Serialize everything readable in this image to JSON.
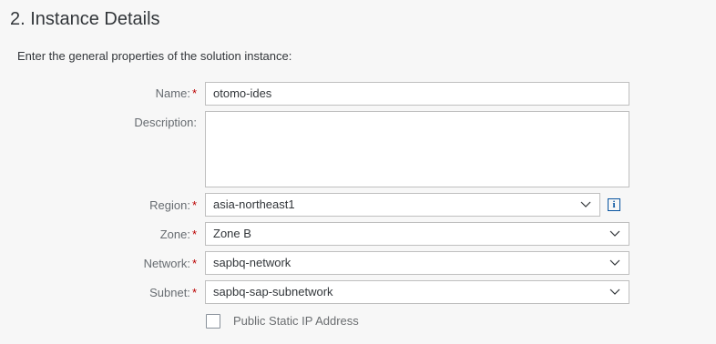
{
  "page": {
    "title": "2. Instance Details",
    "intro": "Enter the general properties of the solution instance:"
  },
  "form": {
    "name": {
      "label": "Name:",
      "required": "*",
      "value": "otomo-ides"
    },
    "description": {
      "label": "Description:",
      "value": ""
    },
    "region": {
      "label": "Region:",
      "required": "*",
      "value": "asia-northeast1",
      "info_icon": "info-icon"
    },
    "zone": {
      "label": "Zone:",
      "required": "*",
      "value": "Zone B"
    },
    "network": {
      "label": "Network:",
      "required": "*",
      "value": "sapbq-network"
    },
    "subnet": {
      "label": "Subnet:",
      "required": "*",
      "value": "sapbq-sap-subnetwork"
    },
    "public_ip": {
      "label": "Public Static IP Address",
      "checked": false
    }
  },
  "colors": {
    "required": "#bb0000",
    "accent": "#0854a0",
    "border": "#bfbfbf",
    "background": "#f7f7f7"
  }
}
